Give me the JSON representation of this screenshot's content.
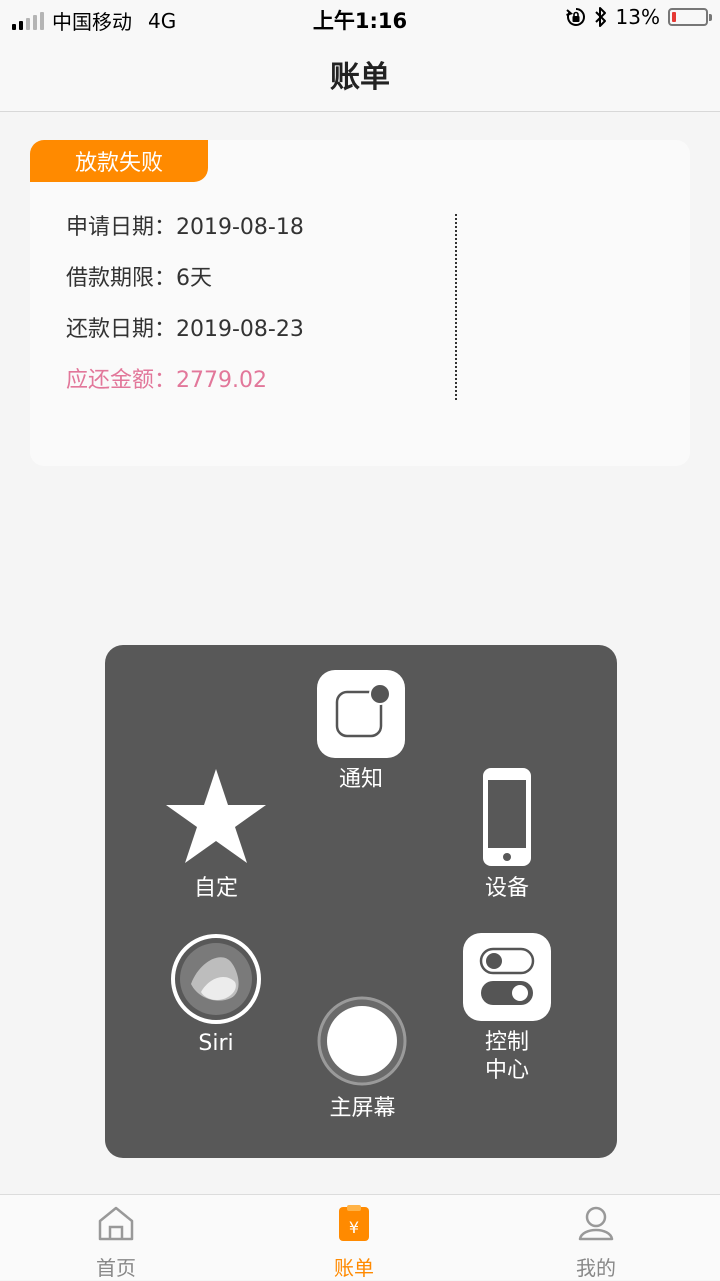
{
  "status_bar": {
    "carrier": "中国移动",
    "network": "4G",
    "time": "上午1:16",
    "battery_text": "13%",
    "battery_level": 0.13
  },
  "header": {
    "title": "账单"
  },
  "bill": {
    "status_tag": "放款失败",
    "apply_date": "申请日期：2019-08-18",
    "loan_term": "借款期限：6天",
    "repay_date": "还款日期：2019-08-23",
    "amount_due": "应还金额：2779.02"
  },
  "assistive_touch": {
    "notification": "通知",
    "custom": "自定",
    "device": "设备",
    "siri": "Siri",
    "control_center": "控制\n中心",
    "home": "主屏幕"
  },
  "tab_bar": {
    "items": [
      {
        "label": "首页",
        "icon": "home-icon"
      },
      {
        "label": "账单",
        "icon": "bill-icon"
      },
      {
        "label": "我的",
        "icon": "profile-icon"
      }
    ],
    "active_index": 1
  },
  "colors": {
    "accent": "#ff8a00",
    "amount_due": "#e2779a",
    "menu_bg": "#585858"
  }
}
